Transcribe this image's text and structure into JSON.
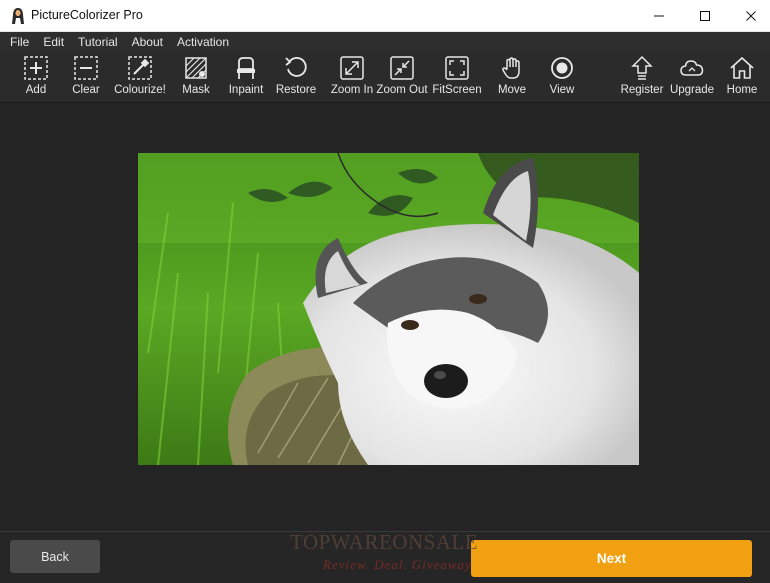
{
  "window": {
    "title": "PictureColorizer Pro"
  },
  "menu": {
    "items": [
      "File",
      "Edit",
      "Tutorial",
      "About",
      "Activation"
    ]
  },
  "toolbar": {
    "tools": [
      {
        "label": "Add",
        "icon": "add-icon"
      },
      {
        "label": "Clear",
        "icon": "clear-icon"
      },
      {
        "label": "Colourize!",
        "icon": "colourize-icon"
      },
      {
        "label": "Mask",
        "icon": "mask-icon"
      },
      {
        "label": "Inpaint",
        "icon": "inpaint-icon"
      },
      {
        "label": "Restore",
        "icon": "restore-icon"
      },
      {
        "label": "Zoom In",
        "icon": "zoom-in-icon"
      },
      {
        "label": "Zoom Out",
        "icon": "zoom-out-icon"
      },
      {
        "label": "FitScreen",
        "icon": "fit-screen-icon"
      },
      {
        "label": "Move",
        "icon": "hand-icon"
      },
      {
        "label": "View",
        "icon": "view-icon"
      },
      {
        "label": "Register",
        "icon": "register-icon"
      },
      {
        "label": "Upgrade",
        "icon": "cloud-icon"
      },
      {
        "label": "Home",
        "icon": "home-icon"
      }
    ]
  },
  "buttons": {
    "back": "Back",
    "next": "Next"
  },
  "watermark": {
    "brand": "TOPWAREONSALE",
    "slogan": "Review. Deal. Giveaway"
  },
  "colors": {
    "accent": "#f0a010",
    "toolbar_bg": "#2b2b2b",
    "canvas_bg": "#242424"
  }
}
